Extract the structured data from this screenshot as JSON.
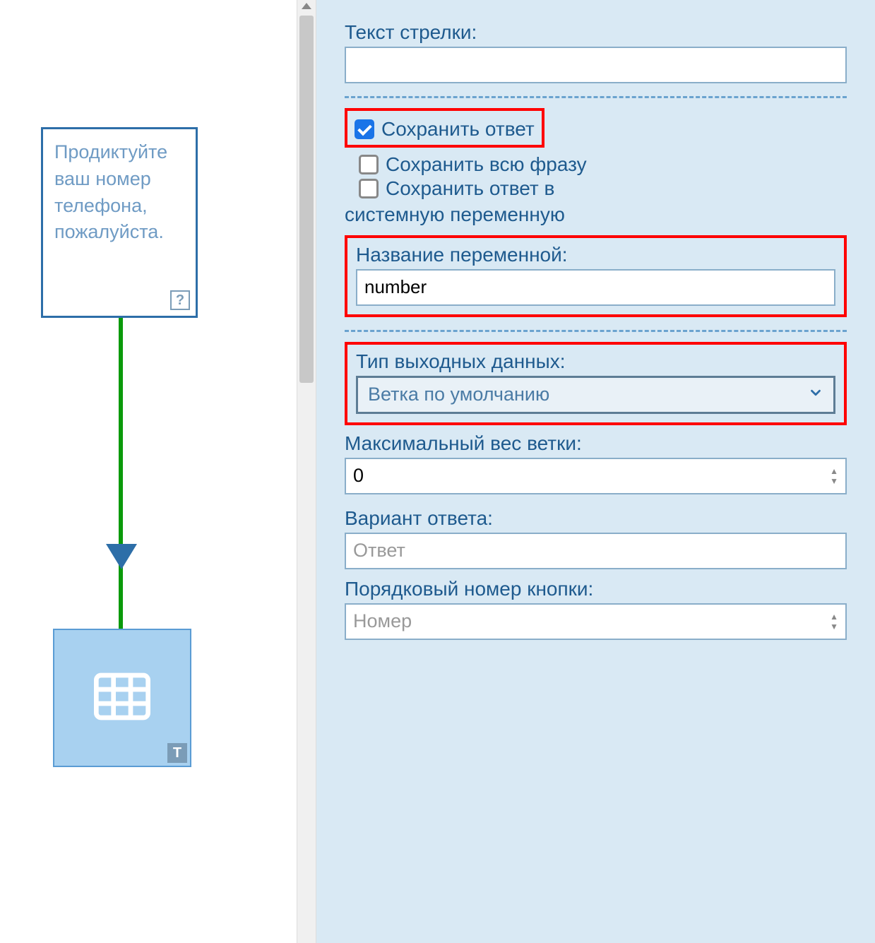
{
  "canvas": {
    "prompt_node_text": "Продиктуйте ваш номер телефона, пожалуйста.",
    "help_icon_label": "?",
    "t_badge_label": "T"
  },
  "panel": {
    "arrow_text": {
      "label": "Текст стрелки:",
      "value": ""
    },
    "checkboxes": {
      "save_answer": {
        "label": "Сохранить ответ",
        "checked": true
      },
      "save_full_phrase": {
        "label": "Сохранить всю фразу",
        "checked": false
      },
      "save_to_sysvar": {
        "label_prefix": "Сохранить ответ в",
        "label_suffix": "системную переменную",
        "checked": false
      }
    },
    "variable_name": {
      "label": "Название переменной:",
      "value": "number"
    },
    "output_type": {
      "label": "Тип выходных данных:",
      "selected": "Ветка по умолчанию"
    },
    "max_branch_weight": {
      "label": "Максимальный вес ветки:",
      "value": "0"
    },
    "answer_variant": {
      "label": "Вариант ответа:",
      "placeholder": "Ответ"
    },
    "button_order": {
      "label": "Порядковый номер кнопки:",
      "placeholder": "Номер"
    }
  }
}
